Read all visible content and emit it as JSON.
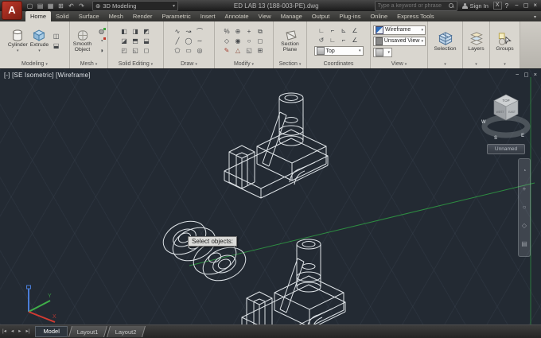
{
  "titlebar": {
    "logo": "A",
    "workspace": "3D Modeling",
    "document_title": "ED LAB 13 (188-003-PE).dwg",
    "search_placeholder": "Type a keyword or phrase",
    "sign_in_label": "Sign In",
    "exchange_label": "X",
    "help_label": "?",
    "window_min": "−",
    "window_restore": "◻",
    "window_close": "×"
  },
  "ribbon": {
    "tabs": [
      "Home",
      "Solid",
      "Surface",
      "Mesh",
      "Render",
      "Parametric",
      "Insert",
      "Annotate",
      "View",
      "Manage",
      "Output",
      "Plug-ins",
      "Online",
      "Express Tools"
    ],
    "panel_toggle": "▾",
    "panels": {
      "modeling": {
        "label": "Modeling",
        "cylinder_label": "Cylinder",
        "extrude_label": "Extrude"
      },
      "mesh": {
        "label": "Mesh",
        "smooth_label": "Smooth Object"
      },
      "solid_editing": {
        "label": "Solid Editing"
      },
      "draw": {
        "label": "Draw"
      },
      "modify": {
        "label": "Modify"
      },
      "section": {
        "label": "Section",
        "plane_label": "Section Plane"
      },
      "coordinates": {
        "label": "Coordinates",
        "dropdown_value": "Top"
      },
      "view": {
        "label": "View",
        "visual_style_value": "Wireframe",
        "named_view_value": "Unsaved View"
      },
      "selection": {
        "label": "Selection"
      },
      "layers": {
        "label": "Layers"
      },
      "groups": {
        "label": "Groups"
      }
    }
  },
  "viewport": {
    "label": "[-] [SE Isometric] [Wireframe]",
    "command_tooltip": "Select objects:",
    "window_min": "−",
    "window_restore": "◻",
    "window_close": "×",
    "viewcube": {
      "top_face": "TOP",
      "left_face": "WEST",
      "right_face": "EAST",
      "compass_south": "S",
      "compass_east": "E",
      "compass_west": "W",
      "ucs_name": "Unnamed"
    },
    "ucs_axis_x": "X",
    "ucs_axis_y": "Y",
    "colors": {
      "wireframe": "#dde2e6",
      "construction_line": "#2f9e44",
      "axis_x": "#d23b32",
      "axis_y": "#3fae49",
      "axis_z": "#4a7dd8"
    }
  },
  "statusbar": {
    "nav_first": "|◂",
    "nav_prev": "◂",
    "nav_next": "▸",
    "nav_last": "▸|",
    "tabs": [
      "Model",
      "Layout1",
      "Layout2"
    ],
    "active_tab": "Model"
  },
  "icon_glyphs": {
    "dropdown": "▾",
    "gear": "⊛",
    "qat": [
      "▢",
      "▤",
      "▦",
      "⊞",
      "↶",
      "↷"
    ],
    "modeling_small": [
      "◫",
      "⬓"
    ],
    "mesh_small": [
      "◍",
      "◔",
      "◑"
    ],
    "solid_editing": [
      "◧",
      "◨",
      "◩",
      "◪",
      "⬒",
      "⬓",
      "◰",
      "◱",
      "◻"
    ],
    "draw": [
      "∿",
      "↝",
      "⌒",
      "╱",
      "◯",
      "∼",
      "⬠",
      "▭",
      "◎"
    ],
    "modify": [
      "%",
      "⊕",
      "+",
      "⧉",
      "◇",
      "◉",
      "○",
      "◻",
      "✎",
      "△",
      "◱",
      "⊞"
    ],
    "coordinates": [
      "∟",
      "⌐",
      "⊾",
      "∠",
      "↺",
      "∟",
      "⌐",
      "∠"
    ],
    "navbar": [
      "◔",
      "+",
      "○",
      "◇",
      "▤"
    ]
  }
}
